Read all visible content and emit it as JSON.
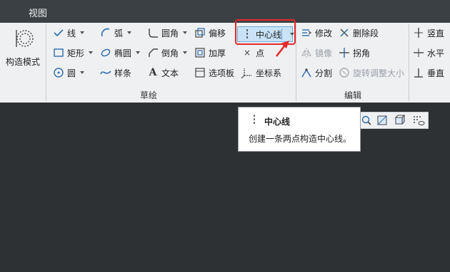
{
  "menu": {
    "tab_view": "视图"
  },
  "mode": {
    "label": "构造模式"
  },
  "sketch": {
    "group_label": "草绘",
    "line": "线",
    "arc": "弧",
    "rectangle": "矩形",
    "ellipse": "椭圆",
    "circle": "圆",
    "spline": "样条",
    "fillet": "圆角",
    "chamfer": "倒角",
    "text": "文本",
    "offset": "偏移",
    "thicken": "加厚",
    "palette": "选项板",
    "centerline": "中心线",
    "point": "点",
    "coord_sys": "坐标系"
  },
  "edit": {
    "group_label": "编辑",
    "modify": "修改",
    "delete_segment": "删除段",
    "mirror": "镜像",
    "corner": "拐角",
    "divide": "分割",
    "rotate_resize": "旋转调整大小"
  },
  "constrain": {
    "vertical": "竖直",
    "horizontal": "水平",
    "perpendicular": "垂直"
  },
  "tooltip": {
    "title": "中心线",
    "description": "创建一条两点构造中心线。"
  },
  "colors": {
    "accent_highlight": "#c9e2f6",
    "annotation_red": "#e62828",
    "icon_blue": "#2b6cb0"
  }
}
